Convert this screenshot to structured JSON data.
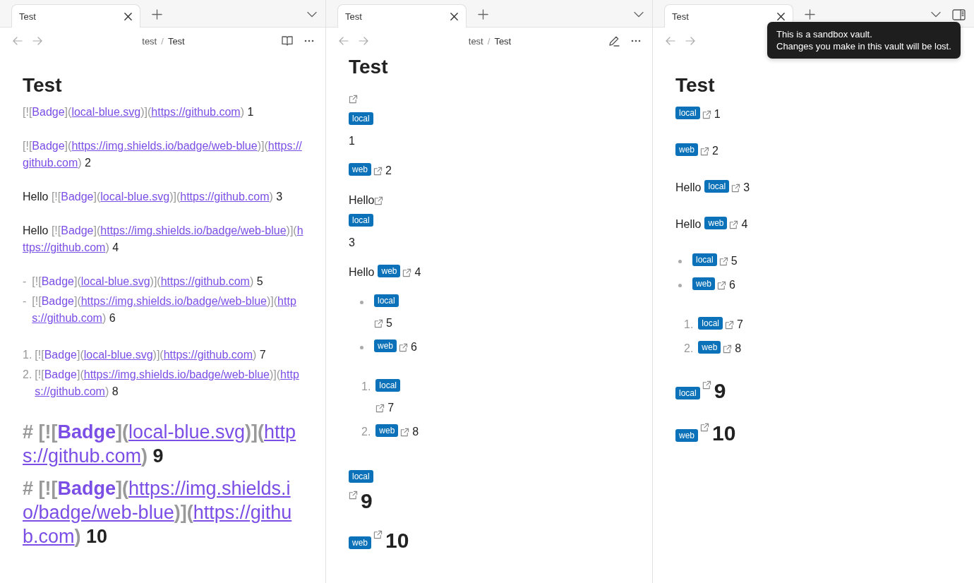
{
  "panes": [
    {
      "kind": "source",
      "tab": {
        "title": "Test",
        "selected": true
      },
      "tab_bar": [
        {
          "kind": "new-tab"
        },
        {
          "kind": "tab-list"
        }
      ],
      "breadcrumb": {
        "folder": "test",
        "separator": "/",
        "file": "Test"
      },
      "actions": [
        {
          "kind": "reading"
        },
        {
          "kind": "more"
        }
      ],
      "blocks": [
        {
          "kind": "title",
          "text": "Test"
        },
        {
          "kind": "line",
          "items": [
            {
              "kind": "mark",
              "text": "[!["
            },
            {
              "kind": "label",
              "text": "Badge"
            },
            {
              "kind": "mark",
              "text": "]("
            },
            {
              "kind": "url",
              "text": "local-blue.svg"
            },
            {
              "kind": "mark",
              "text": ")]("
            },
            {
              "kind": "url",
              "text": "https://github.com"
            },
            {
              "kind": "mark",
              "text": ")"
            },
            {
              "kind": "text",
              "text": " 1"
            }
          ]
        },
        {
          "kind": "line",
          "items": [
            {
              "kind": "mark",
              "text": "[!["
            },
            {
              "kind": "label",
              "text": "Badge"
            },
            {
              "kind": "mark",
              "text": "]("
            },
            {
              "kind": "url",
              "text": "https://img.shields.io/badge/web-blue"
            },
            {
              "kind": "mark",
              "text": ")]("
            },
            {
              "kind": "url",
              "text": "https://github.com"
            },
            {
              "kind": "mark",
              "text": ")"
            },
            {
              "kind": "text",
              "text": " 2"
            }
          ]
        },
        {
          "kind": "line",
          "items": [
            {
              "kind": "text",
              "text": "Hello "
            },
            {
              "kind": "mark",
              "text": "[!["
            },
            {
              "kind": "label",
              "text": "Badge"
            },
            {
              "kind": "mark",
              "text": "]("
            },
            {
              "kind": "url",
              "text": "local-blue.svg"
            },
            {
              "kind": "mark",
              "text": ")]("
            },
            {
              "kind": "url",
              "text": "https://github.com"
            },
            {
              "kind": "mark",
              "text": ")"
            },
            {
              "kind": "text",
              "text": " 3"
            }
          ]
        },
        {
          "kind": "line",
          "items": [
            {
              "kind": "text",
              "text": "Hello "
            },
            {
              "kind": "mark",
              "text": "[!["
            },
            {
              "kind": "label",
              "text": "Badge"
            },
            {
              "kind": "mark",
              "text": "]("
            },
            {
              "kind": "url",
              "text": "https://img.shields.io/badge/web-blue"
            },
            {
              "kind": "mark",
              "text": ")]("
            },
            {
              "kind": "url",
              "text": "https://github.com"
            },
            {
              "kind": "mark",
              "text": ")"
            },
            {
              "kind": "text",
              "text": " 4"
            }
          ]
        },
        {
          "kind": "bullets",
          "entries": [
            {
              "marker": "-",
              "items": [
                {
                  "kind": "mark",
                  "text": "[!["
                },
                {
                  "kind": "label",
                  "text": "Badge"
                },
                {
                  "kind": "mark",
                  "text": "]("
                },
                {
                  "kind": "url",
                  "text": "local-blue.svg"
                },
                {
                  "kind": "mark",
                  "text": ")]("
                },
                {
                  "kind": "url",
                  "text": "https://github.com"
                },
                {
                  "kind": "mark",
                  "text": ")"
                },
                {
                  "kind": "text",
                  "text": " 5"
                }
              ]
            },
            {
              "marker": "-",
              "items": [
                {
                  "kind": "mark",
                  "text": "[!["
                },
                {
                  "kind": "label",
                  "text": "Badge"
                },
                {
                  "kind": "mark",
                  "text": "]("
                },
                {
                  "kind": "url",
                  "text": "https://img.shields.io/badge/web-blue"
                },
                {
                  "kind": "mark",
                  "text": ")]("
                },
                {
                  "kind": "url",
                  "text": "https://github.com"
                },
                {
                  "kind": "mark",
                  "text": ")"
                },
                {
                  "kind": "text",
                  "text": " 6"
                }
              ]
            }
          ]
        },
        {
          "kind": "numbers",
          "entries": [
            {
              "marker": "1.",
              "items": [
                {
                  "kind": "mark",
                  "text": "[!["
                },
                {
                  "kind": "label",
                  "text": "Badge"
                },
                {
                  "kind": "mark",
                  "text": "]("
                },
                {
                  "kind": "url",
                  "text": "local-blue.svg"
                },
                {
                  "kind": "mark",
                  "text": ")]("
                },
                {
                  "kind": "url",
                  "text": "https://github.com"
                },
                {
                  "kind": "mark",
                  "text": ")"
                },
                {
                  "kind": "text",
                  "text": " 7"
                }
              ]
            },
            {
              "marker": "2.",
              "items": [
                {
                  "kind": "mark",
                  "text": "[!["
                },
                {
                  "kind": "label",
                  "text": "Badge"
                },
                {
                  "kind": "mark",
                  "text": "]("
                },
                {
                  "kind": "url",
                  "text": "https://img.shields.io/badge/web-blue"
                },
                {
                  "kind": "mark",
                  "text": ")]("
                },
                {
                  "kind": "url",
                  "text": "https://github.com"
                },
                {
                  "kind": "mark",
                  "text": ")"
                },
                {
                  "kind": "text",
                  "text": " 8"
                }
              ]
            }
          ]
        },
        {
          "kind": "heading",
          "items": [
            {
              "kind": "mark",
              "text": "# [!["
            },
            {
              "kind": "label",
              "text": "Badge"
            },
            {
              "kind": "mark",
              "text": "]("
            },
            {
              "kind": "url",
              "text": "local-blue.svg"
            },
            {
              "kind": "mark",
              "text": ")]("
            },
            {
              "kind": "url",
              "text": "https://github.com"
            },
            {
              "kind": "mark",
              "text": ")"
            },
            {
              "kind": "text",
              "text": " 9"
            }
          ]
        },
        {
          "kind": "heading",
          "items": [
            {
              "kind": "mark",
              "text": "# [!["
            },
            {
              "kind": "label",
              "text": "Badge"
            },
            {
              "kind": "mark",
              "text": "]("
            },
            {
              "kind": "url",
              "text": "https://img.shields.io/badge/web-blue"
            },
            {
              "kind": "mark",
              "text": ")]("
            },
            {
              "kind": "url",
              "text": "https://github.com"
            },
            {
              "kind": "mark",
              "text": ")"
            },
            {
              "kind": "text",
              "text": " 10"
            }
          ]
        }
      ]
    },
    {
      "kind": "reading",
      "tab": {
        "title": "Test",
        "selected": true
      },
      "tab_bar": [
        {
          "kind": "new-tab"
        },
        {
          "kind": "tab-list"
        }
      ],
      "breadcrumb": {
        "folder": "test",
        "separator": "/",
        "file": "Test"
      },
      "actions": [
        {
          "kind": "edit"
        },
        {
          "kind": "more"
        }
      ],
      "blocks": [
        {
          "kind": "title",
          "text": "Test"
        },
        {
          "kind": "line",
          "items": [
            {
              "kind": "link-icon"
            },
            {
              "kind": "break"
            },
            {
              "kind": "badge",
              "text": "local"
            },
            {
              "kind": "break"
            },
            {
              "kind": "text",
              "text": "1"
            }
          ]
        },
        {
          "kind": "line",
          "items": [
            {
              "kind": "badge",
              "text": "web"
            },
            {
              "kind": "link-icon"
            },
            {
              "kind": "text",
              "text": "2"
            }
          ]
        },
        {
          "kind": "line",
          "items": [
            {
              "kind": "text",
              "text": "Hello"
            },
            {
              "kind": "link-icon"
            },
            {
              "kind": "break"
            },
            {
              "kind": "badge",
              "text": "local"
            },
            {
              "kind": "break"
            },
            {
              "kind": "text",
              "text": "3"
            }
          ]
        },
        {
          "kind": "line",
          "items": [
            {
              "kind": "text",
              "text": "Hello"
            },
            {
              "kind": "badge",
              "text": "web"
            },
            {
              "kind": "link-icon"
            },
            {
              "kind": "text",
              "text": "4"
            }
          ]
        },
        {
          "kind": "bullets",
          "entries": [
            {
              "items": [
                {
                  "kind": "badge",
                  "text": "local"
                },
                {
                  "kind": "break"
                },
                {
                  "kind": "link-icon"
                },
                {
                  "kind": "text",
                  "text": "5"
                }
              ]
            },
            {
              "items": [
                {
                  "kind": "badge",
                  "text": "web"
                },
                {
                  "kind": "link-icon"
                },
                {
                  "kind": "text",
                  "text": "6"
                }
              ]
            }
          ]
        },
        {
          "kind": "numbers",
          "entries": [
            {
              "marker": "1.",
              "items": [
                {
                  "kind": "badge",
                  "text": "local"
                },
                {
                  "kind": "break"
                },
                {
                  "kind": "link-icon"
                },
                {
                  "kind": "text",
                  "text": "7"
                }
              ]
            },
            {
              "marker": "2.",
              "items": [
                {
                  "kind": "badge",
                  "text": "web"
                },
                {
                  "kind": "link-icon"
                },
                {
                  "kind": "text",
                  "text": "8"
                }
              ]
            }
          ]
        },
        {
          "kind": "heading",
          "items": [
            {
              "kind": "badge",
              "text": "local"
            },
            {
              "kind": "break"
            },
            {
              "kind": "link-icon"
            },
            {
              "kind": "text",
              "text": "9"
            }
          ]
        },
        {
          "kind": "heading",
          "items": [
            {
              "kind": "badge",
              "text": "web"
            },
            {
              "kind": "link-icon"
            },
            {
              "kind": "text",
              "text": "10"
            }
          ]
        }
      ]
    },
    {
      "kind": "live",
      "tab": {
        "title": "Test",
        "selected": true
      },
      "tab_bar": [
        {
          "kind": "new-tab"
        },
        {
          "kind": "tab-list"
        },
        {
          "kind": "sidebar-toggle"
        }
      ],
      "blocks": [
        {
          "kind": "title",
          "text": "Test"
        },
        {
          "kind": "line",
          "items": [
            {
              "kind": "badge",
              "text": "local"
            },
            {
              "kind": "link-icon"
            },
            {
              "kind": "text",
              "text": "1"
            }
          ]
        },
        {
          "kind": "line",
          "items": [
            {
              "kind": "badge",
              "text": "web"
            },
            {
              "kind": "link-icon"
            },
            {
              "kind": "text",
              "text": "2"
            }
          ]
        },
        {
          "kind": "line",
          "items": [
            {
              "kind": "text",
              "text": "Hello"
            },
            {
              "kind": "badge",
              "text": "local"
            },
            {
              "kind": "link-icon"
            },
            {
              "kind": "text",
              "text": "3"
            }
          ]
        },
        {
          "kind": "line",
          "items": [
            {
              "kind": "text",
              "text": "Hello"
            },
            {
              "kind": "badge",
              "text": "web"
            },
            {
              "kind": "link-icon"
            },
            {
              "kind": "text",
              "text": "4"
            }
          ]
        },
        {
          "kind": "bullets",
          "entries": [
            {
              "items": [
                {
                  "kind": "badge",
                  "text": "local"
                },
                {
                  "kind": "link-icon"
                },
                {
                  "kind": "text",
                  "text": "5"
                }
              ]
            },
            {
              "items": [
                {
                  "kind": "badge",
                  "text": "web"
                },
                {
                  "kind": "link-icon"
                },
                {
                  "kind": "text",
                  "text": "6"
                }
              ]
            }
          ]
        },
        {
          "kind": "numbers",
          "entries": [
            {
              "marker": "1.",
              "items": [
                {
                  "kind": "badge",
                  "text": "local"
                },
                {
                  "kind": "link-icon"
                },
                {
                  "kind": "text",
                  "text": "7"
                }
              ]
            },
            {
              "marker": "2.",
              "items": [
                {
                  "kind": "badge",
                  "text": "web"
                },
                {
                  "kind": "link-icon"
                },
                {
                  "kind": "text",
                  "text": "8"
                }
              ]
            }
          ]
        },
        {
          "kind": "heading",
          "items": [
            {
              "kind": "badge",
              "text": "local"
            },
            {
              "kind": "link-icon"
            },
            {
              "kind": "text",
              "text": "9"
            }
          ]
        },
        {
          "kind": "heading",
          "items": [
            {
              "kind": "badge",
              "text": "web"
            },
            {
              "kind": "link-icon"
            },
            {
              "kind": "text",
              "text": "10"
            }
          ]
        }
      ],
      "tooltip": {
        "lines": [
          "This is a sandbox vault.",
          "Changes you make in this vault will be lost."
        ]
      }
    }
  ]
}
